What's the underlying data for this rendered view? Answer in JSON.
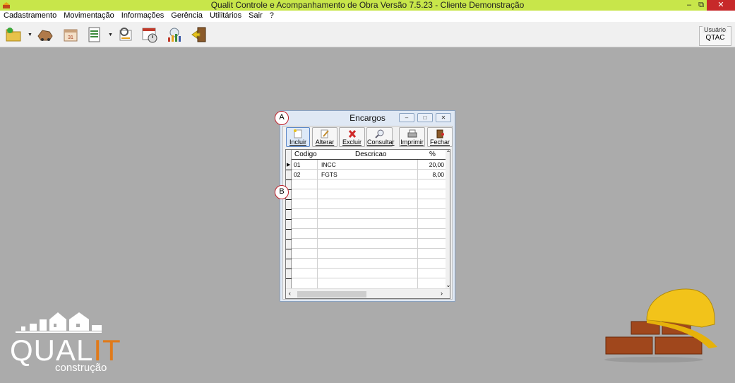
{
  "window": {
    "title": "Qualit Controle e Acompanhamento de Obra Versão 7.5.23 - Cliente Demonstração",
    "minimize": "–",
    "restore": "⧉",
    "close": "✕"
  },
  "menubar": {
    "items": [
      "Cadastramento",
      "Movimentação",
      "Informações",
      "Gerência",
      "Utilitários",
      "Sair",
      "?"
    ]
  },
  "toolbar": {
    "icons": [
      "folder-icon",
      "car-icon",
      "calendar-icon",
      "report-icon",
      "search-report-icon",
      "calendar-clock-icon",
      "chart-icon",
      "exit-door-icon"
    ]
  },
  "user": {
    "label": "Usuário",
    "value": "QTAC"
  },
  "child": {
    "title": "Encargos",
    "min": "–",
    "max": "□",
    "close": "✕",
    "buttons": {
      "incluir": "Incluir",
      "alterar": "Alterar",
      "excluir": "Excluir",
      "consultar": "Consultar",
      "imprimir": "Imprimir",
      "fechar": "Fechar"
    },
    "grid": {
      "headers": {
        "codigo": "Codigo",
        "descricao": "Descricao",
        "pct": "%"
      },
      "rows": [
        {
          "codigo": "01",
          "descricao": "INCC",
          "pct": "20,00"
        },
        {
          "codigo": "02",
          "descricao": "FGTS",
          "pct": "8,00"
        }
      ]
    }
  },
  "markers": {
    "a": "A",
    "b": "B"
  },
  "logo": {
    "brand": "QUALIT",
    "sub": "construção"
  },
  "colors": {
    "titlebar": "#c8e64a",
    "desktop": "#ababab",
    "close": "#c7292a",
    "marker": "#c0202a",
    "logo_accent": "#e07a1a"
  }
}
